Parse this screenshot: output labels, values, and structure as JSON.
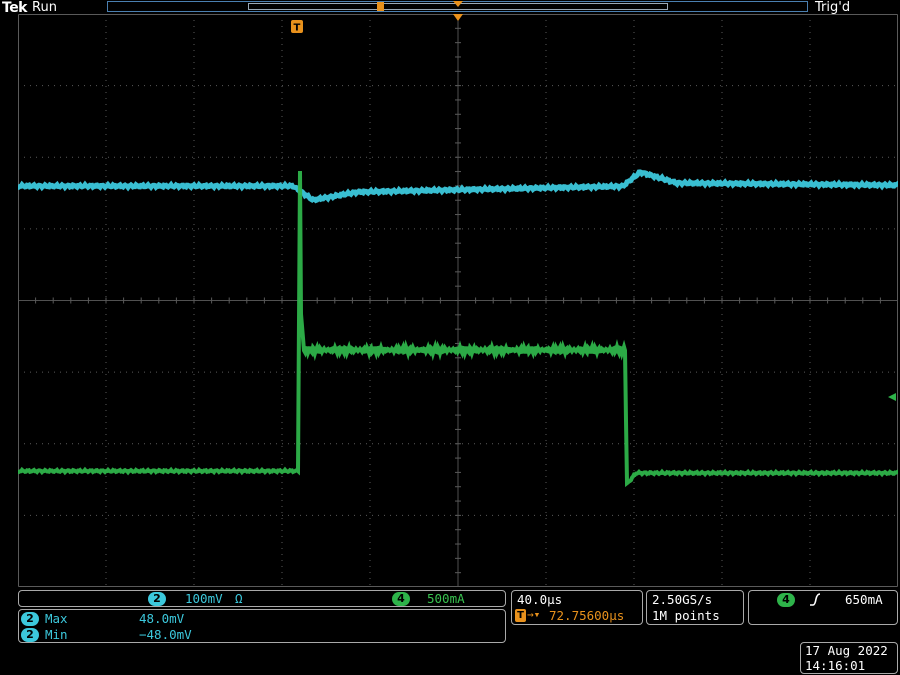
{
  "status": {
    "brand": "Tek",
    "mode": "Run",
    "trigger_state": "Trig'd"
  },
  "colors": {
    "ch2": "#3cc8dc",
    "ch4": "#2eb34a",
    "trigger": "#e8911c",
    "grid": "#5a5a5a"
  },
  "markers": {
    "ch2": "2",
    "ch4": "4",
    "trigger": "T"
  },
  "channels": {
    "ch2": {
      "label": "2",
      "scale": "100mV",
      "unit_symbol": "Ω"
    },
    "ch4": {
      "label": "4",
      "scale": "500mA"
    }
  },
  "measurements": [
    {
      "channel": "2",
      "name": "Max",
      "value": "48.0mV"
    },
    {
      "channel": "2",
      "name": "Min",
      "value": "−48.0mV"
    }
  ],
  "timebase": {
    "scale": "40.0µs",
    "trigger_prefix": "T",
    "trigger_delay": "72.75600µs"
  },
  "acquisition": {
    "sample_rate": "2.50GS/s",
    "record_length": "1M points"
  },
  "trigger": {
    "source": "4",
    "slope_icon": "rising-edge-icon",
    "level": "650mA"
  },
  "datetime": {
    "date": "17 Aug 2022",
    "time": "14:16:01"
  }
}
